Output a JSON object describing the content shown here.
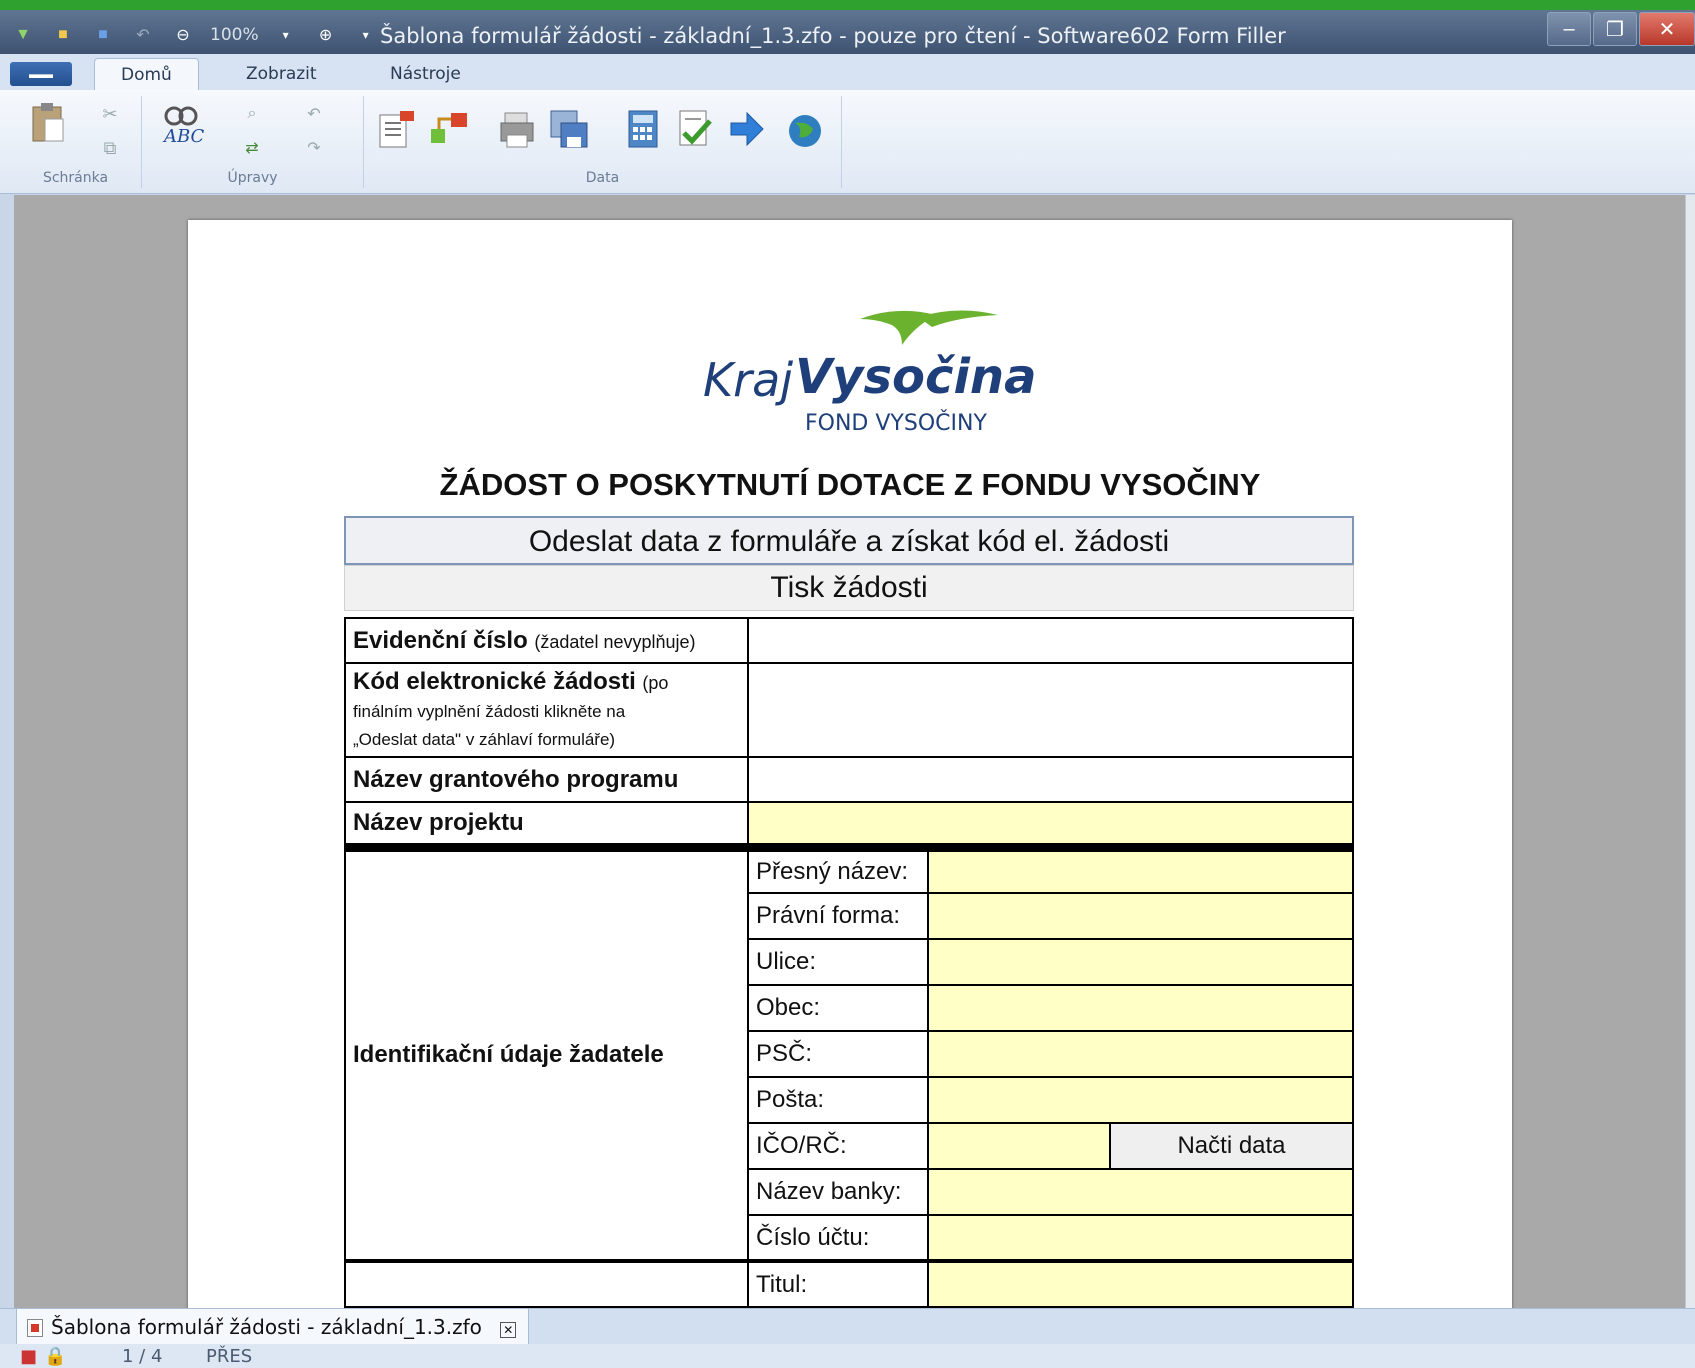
{
  "window": {
    "title": "Šablona formulář žádosti - základní_1.3.zfo - pouze pro čtení - Software602 Form Filler",
    "zoom": "100%"
  },
  "ribbon": {
    "tabs": [
      "Domů",
      "Zobrazit",
      "Nástroje"
    ],
    "active_tab": "Domů",
    "groups": [
      "Schránka",
      "Úpravy",
      "Data"
    ]
  },
  "logo": {
    "kraj": "Kraj",
    "vysocina": "Vysočina",
    "fond": "FOND VYSOČINY"
  },
  "form": {
    "title": "ŽÁDOST O POSKYTNUTÍ DOTACE Z FONDU VYSOČINY",
    "send_button": "Odeslat data z formuláře a získat kód el. žádosti",
    "print_button": "Tisk žádosti",
    "evidencni_label": "Evidenční číslo",
    "evidencni_note": "(žadatel nevyplňuje)",
    "kod_label": "Kód elektronické žádosti",
    "kod_note_1": "(po",
    "kod_note_2": "finálním vyplnění žádosti klikněte na",
    "kod_note_3": "„Odeslat data\" v záhlaví formuláře)",
    "grant_label": "Název grantového programu",
    "projekt_label": "Název projektu",
    "ident_label": "Identifikační údaje žadatele",
    "fields": {
      "presny_nazev": "Přesný název:",
      "pravni_forma": "Právní forma:",
      "ulice": "Ulice:",
      "obec": "Obec:",
      "psc": "PSČ:",
      "posta": "Pošta:",
      "ico": "IČO/RČ:",
      "nazev_banky": "Název banky:",
      "cislo_uctu": "Číslo účtu:",
      "titul": "Titul:"
    },
    "load_button": "Načti data"
  },
  "document_tab": {
    "label": "Šablona formulář žádosti - základní_1.3.zfo"
  },
  "status": {
    "page": "1 / 4",
    "mode": "PŘES"
  },
  "colors": {
    "field_yellow": "#ffffc6",
    "logo_blue": "#1f3f7a",
    "logo_green": "#6bb22f"
  }
}
